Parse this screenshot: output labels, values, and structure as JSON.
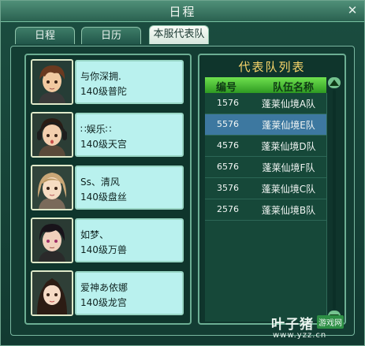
{
  "window": {
    "title": "日程"
  },
  "tabs": [
    {
      "label": "日程",
      "active": false
    },
    {
      "label": "日历",
      "active": false
    },
    {
      "label": "本服代表队",
      "active": true
    }
  ],
  "members": [
    {
      "name": "与你深拥.",
      "level": "140级普陀",
      "avatar": "avatar-boy-brown-hair"
    },
    {
      "name": "∷娱乐∷",
      "level": "140级天宫",
      "avatar": "avatar-girl-headphones"
    },
    {
      "name": "Ss、清风",
      "level": "140级盘丝",
      "avatar": "avatar-girl-light-hair"
    },
    {
      "name": "如梦、",
      "level": "140级万兽",
      "avatar": "avatar-boy-dark-hair"
    },
    {
      "name": "爱神あ依娜",
      "level": "140级龙宫",
      "avatar": "avatar-girl-black-hair"
    }
  ],
  "team_list": {
    "title": "代表队列表",
    "columns": [
      "编号",
      "队伍名称"
    ],
    "rows": [
      {
        "id": "1576",
        "name": "蓬莱仙境A队"
      },
      {
        "id": "5576",
        "name": "蓬莱仙境E队",
        "selected": true
      },
      {
        "id": "4576",
        "name": "蓬莱仙境D队"
      },
      {
        "id": "6576",
        "name": "蓬莱仙境F队"
      },
      {
        "id": "3576",
        "name": "蓬莱仙境C队"
      },
      {
        "id": "2576",
        "name": "蓬莱仙境B队"
      }
    ]
  },
  "watermark": {
    "brand": "叶子猪",
    "tag": "游戏网",
    "url": "www.yzz.cn"
  },
  "colors": {
    "accent_gold": "#f7d56a",
    "header_green": "#2e9a22",
    "selected_row": "#3d78a0",
    "info_box": "#b9f1ee"
  }
}
